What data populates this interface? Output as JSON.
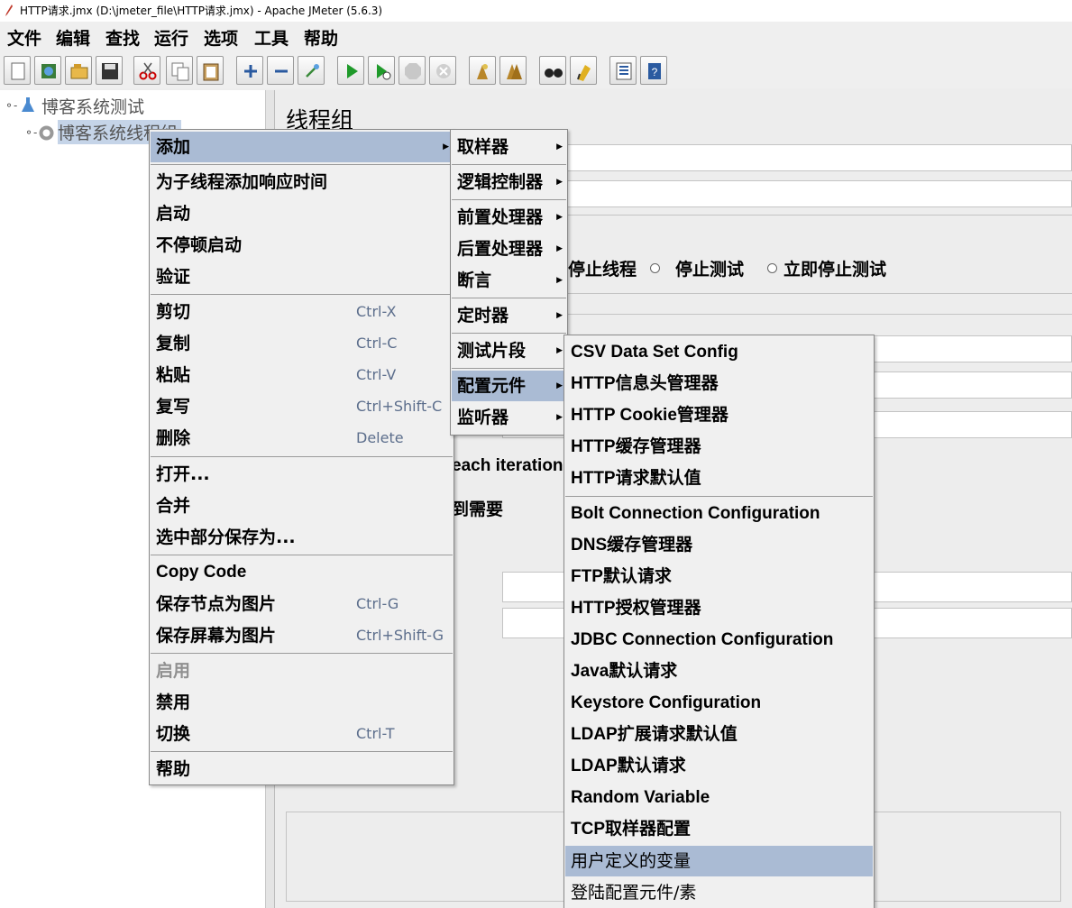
{
  "window": {
    "title": "HTTP请求.jmx (D:\\jmeter_file\\HTTP请求.jmx) - Apache JMeter (5.6.3)"
  },
  "menubar": [
    "文件",
    "编辑",
    "查找",
    "运行",
    "选项",
    "工具",
    "帮助"
  ],
  "toolbar": {
    "icons": [
      "new-icon",
      "templates-icon",
      "open-icon",
      "save-icon",
      "cut-icon",
      "copy-icon",
      "paste-icon",
      "expand-icon",
      "collapse-icon",
      "toggle-icon",
      "start-icon",
      "start-no-pause-icon",
      "stop-icon",
      "shutdown-icon",
      "clear-icon",
      "clear-all-icon",
      "search-icon",
      "reset-search-icon",
      "function-helper-icon",
      "help-icon"
    ]
  },
  "tree": {
    "root": "博客系统测试",
    "child": "博客系统线程组"
  },
  "right": {
    "title": "线程组",
    "radio_labels": [
      "停止线程",
      "停止测试",
      "立即停止测试"
    ],
    "partial_each_iteration": "each iteration",
    "partial_needed": "到需要"
  },
  "context_menu": {
    "add": "添加",
    "add_think_times": "为子线程添加响应时间",
    "start": "启动",
    "start_no_pause": "不停顿启动",
    "validate": "验证",
    "cut": "剪切",
    "cut_sc": "Ctrl-X",
    "copy": "复制",
    "copy_sc": "Ctrl-C",
    "paste": "粘贴",
    "paste_sc": "Ctrl-V",
    "duplicate": "复写",
    "duplicate_sc": "Ctrl+Shift-C",
    "delete": "删除",
    "delete_sc": "Delete",
    "open": "打开...",
    "merge": "合并",
    "save_selection": "选中部分保存为...",
    "copy_code": "Copy Code",
    "save_node_image": "保存节点为图片",
    "save_node_image_sc": "Ctrl-G",
    "save_screen_image": "保存屏幕为图片",
    "save_screen_image_sc": "Ctrl+Shift-G",
    "enable": "启用",
    "disable": "禁用",
    "toggle": "切换",
    "toggle_sc": "Ctrl-T",
    "help": "帮助"
  },
  "add_submenu": {
    "sampler": "取样器",
    "logic_controller": "逻辑控制器",
    "pre_processor": "前置处理器",
    "post_processor": "后置处理器",
    "assertion": "断言",
    "timer": "定时器",
    "test_fragment": "测试片段",
    "config_element": "配置元件",
    "listener": "监听器"
  },
  "config_submenu": {
    "items": [
      "CSV Data Set Config",
      "HTTP信息头管理器",
      "HTTP Cookie管理器",
      "HTTP缓存管理器",
      "HTTP请求默认值",
      "Bolt Connection Configuration",
      "DNS缓存管理器",
      "FTP默认请求",
      "HTTP授权管理器",
      "JDBC Connection Configuration",
      "Java默认请求",
      "Keystore Configuration",
      "LDAP扩展请求默认值",
      "LDAP默认请求",
      "Random Variable",
      "TCP取样器配置",
      "用户定义的变量",
      "登陆配置元件/素"
    ]
  }
}
